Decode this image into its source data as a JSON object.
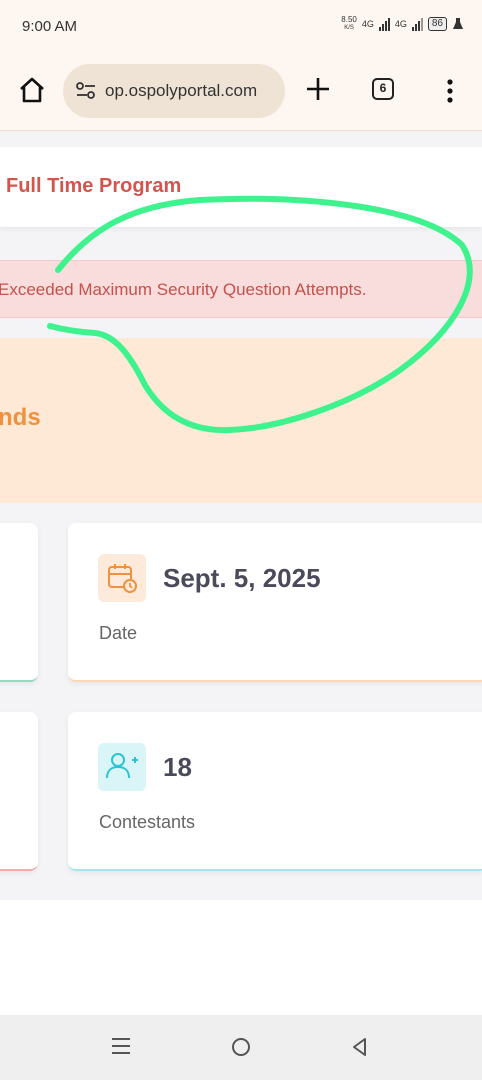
{
  "status_bar": {
    "time": "9:00 AM",
    "net_speed_value": "8.50",
    "net_speed_unit": "K/S",
    "network_1": "4G",
    "network_2": "4G",
    "battery": "86"
  },
  "browser": {
    "url": "op.ospolyportal.com",
    "tab_count": "6",
    "icons": [
      "home-icon",
      "site-settings-icon",
      "new-tab-icon",
      "tab-switcher-icon",
      "more-menu-icon"
    ]
  },
  "page": {
    "program_title": "Full Time Program",
    "alert_message": "Exceeded Maximum Security Question Attempts.",
    "orange_banner_text": "nds",
    "cards": [
      {
        "value": "Sept. 5, 2025",
        "label": "Date",
        "icon": "calendar-clock-icon",
        "accent": "#f0923d"
      },
      {
        "value": "18",
        "label": "Contestants",
        "icon": "add-user-icon",
        "accent": "#2cc3d6"
      }
    ]
  },
  "annotation": {
    "color": "#3ef28e",
    "shape": "hand-drawn circle around alert"
  },
  "nav_bar": {
    "icons": [
      "recent-apps-icon",
      "home-circle-icon",
      "back-icon"
    ]
  },
  "colors": {
    "alert_text": "#c6504c",
    "alert_bg": "#f9dcdc",
    "program_title": "#d2554e",
    "orange_panel_bg": "#fde9d6",
    "orange_text": "#f0923d"
  }
}
